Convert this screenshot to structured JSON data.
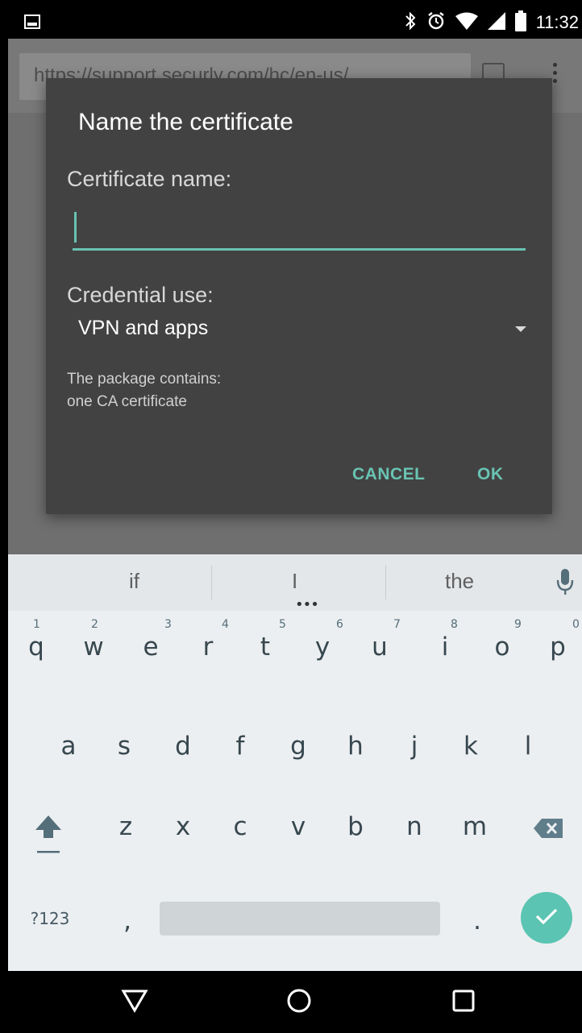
{
  "status_bar": {
    "time": "11:32",
    "icons": [
      "gallery-notification-icon",
      "bluetooth-icon",
      "alarm-icon",
      "wifi-icon",
      "signal-icon",
      "battery-icon"
    ]
  },
  "browser": {
    "url": "https://support.securly.com/hc/en-us/"
  },
  "dialog": {
    "title": "Name the certificate",
    "certificate_label": "Certificate name:",
    "certificate_value": "",
    "credential_label": "Credential use:",
    "credential_value": "VPN and apps",
    "package_line1": "The package contains:",
    "package_line2": "one CA certificate",
    "cancel_label": "CANCEL",
    "ok_label": "OK"
  },
  "keyboard": {
    "suggestions": [
      "if",
      "I",
      "the"
    ],
    "more_dots": "•••",
    "row1": [
      "q",
      "w",
      "e",
      "r",
      "t",
      "y",
      "u",
      "i",
      "o",
      "p"
    ],
    "row1_numbers": [
      "1",
      "2",
      "3",
      "4",
      "5",
      "6",
      "7",
      "8",
      "9",
      "0"
    ],
    "row2": [
      "a",
      "s",
      "d",
      "f",
      "g",
      "h",
      "j",
      "k",
      "l"
    ],
    "row3": [
      "z",
      "x",
      "c",
      "v",
      "b",
      "n",
      "m"
    ],
    "symbols_label": "?123",
    "comma": ",",
    "period": "."
  },
  "colors": {
    "accent": "#69c3b2",
    "dialog_bg": "#424242",
    "keyboard_bg": "#eceff1"
  }
}
